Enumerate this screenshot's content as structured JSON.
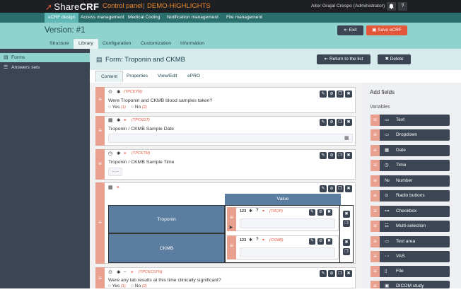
{
  "topbar": {
    "logo_prefix": "Share",
    "logo_suffix": "CRF",
    "control_panel": "Control panel",
    "separator": "|",
    "project": "DEMO-HIGHLIGHTS",
    "user": "Aitor Grajal Crespo (Administrator)",
    "bell_icon": "bell-icon",
    "help_label": "?"
  },
  "nav": [
    "eCRF design",
    "Access management",
    "Medical Coding",
    "Notification management",
    "File management"
  ],
  "version": "Version: #1",
  "exit_label": "Exit",
  "save_label": "Save eCRF",
  "subtabs": [
    "Structure",
    "Library",
    "Configuration",
    "Customization",
    "Information"
  ],
  "sidebar": {
    "forms": "Forms",
    "answers_sets": "Answers sets"
  },
  "form": {
    "title": "Form: Troponin and CKMB",
    "return_label": "Return to the list",
    "delete_label": "Delete"
  },
  "content_tabs": [
    "Content",
    "Properties",
    "View/Edit",
    "ePRO"
  ],
  "questions": {
    "q1": {
      "code": "(TPCKYN)",
      "text": "Were Troponin and CKMB blood samples taken?",
      "opt_yes": "Yes",
      "opt_yes_val": "(1)",
      "opt_no": "No",
      "opt_no_val": "(2)"
    },
    "q2": {
      "code": "(TPCKDT)",
      "text": "Troponin / CKMB Sample Date"
    },
    "q3": {
      "code": "(TPCKTM)",
      "text": "Troponin / CKMB Sample Time",
      "placeholder": "--:--"
    },
    "q4": {
      "value_header": "Value",
      "row1": "Troponin",
      "row2": "CKMB",
      "num_label": "123",
      "code1": "(TROP)",
      "code2": "(CKMB)",
      "q_mark": "?"
    },
    "q5": {
      "code": "(TPCKCSYN)",
      "text": "Were any lab results at this time clinically significant?",
      "opt_yes": "Yes",
      "opt_yes_val": "(1)",
      "opt_no": "No",
      "opt_no_val": "(2)"
    }
  },
  "right": {
    "title": "Add fields",
    "variables": "Variables",
    "fields": [
      "Text",
      "Dropdown",
      "Date",
      "Time",
      "Number",
      "Radio buttons",
      "Checkbox",
      "Multi-selection",
      "Text area",
      "VAS",
      "File",
      "DICOM study"
    ]
  },
  "colors": {
    "accent": "#e4563a",
    "teal": "#8fd2ce",
    "dark": "#3c4554",
    "handle": "#e9a08e"
  }
}
